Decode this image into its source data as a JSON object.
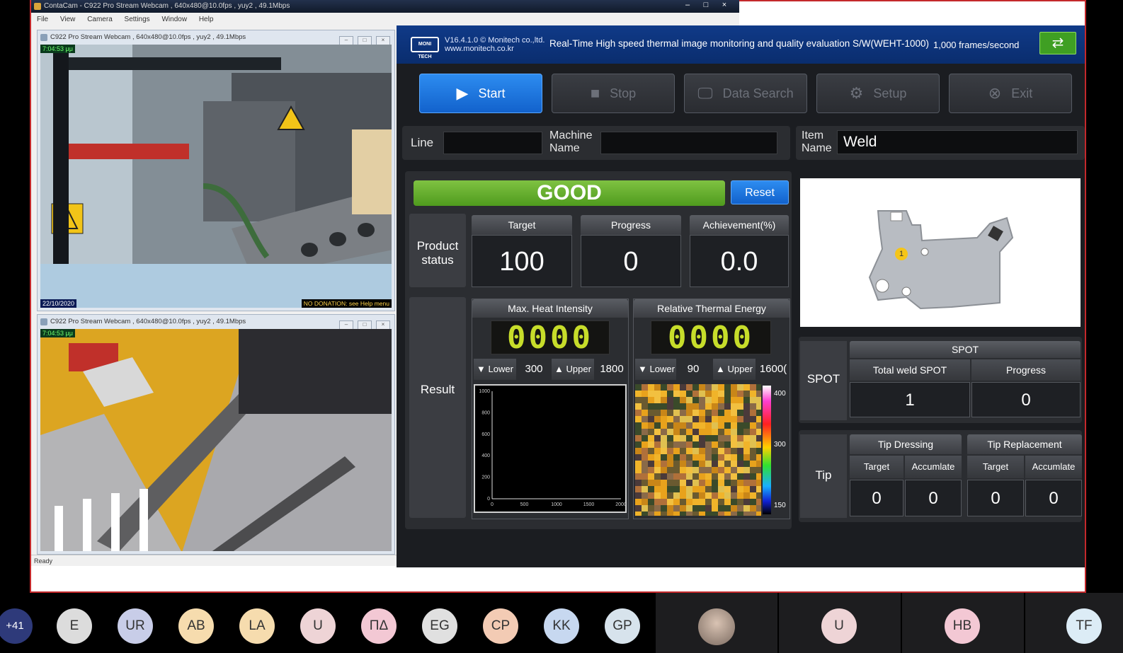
{
  "contacam": {
    "title": "ContaCam - C922 Pro Stream Webcam , 640x480@10.0fps , yuy2 , 49.1Mbps",
    "menu": [
      "File",
      "View",
      "Camera",
      "Settings",
      "Window",
      "Help"
    ],
    "window_controls": [
      "–",
      "□",
      "×"
    ],
    "cam1_title": "C922 Pro Stream Webcam , 640x480@10.0fps , yuy2 , 49.1Mbps",
    "cam2_title": "C922 Pro Stream Webcam , 640x480@10.0fps , yuy2 , 49.1Mbps",
    "cam1_timestamp": "7:04:53 μμ",
    "cam2_timestamp": "7:04:53 μμ",
    "cam1_date": "22/10/2020",
    "donation_text": "NO DONATION: see Help menu",
    "status": "Ready"
  },
  "app": {
    "version_line1": "V16.4.1.0 © Monitech co.,ltd.",
    "version_line2": "www.monitech.co.kr",
    "logo_text": "MONI TECH",
    "title": "Real-Time High speed thermal image monitoring and quality evaluation S/W(WEHT-1000)",
    "fps": "1,000 frames/second",
    "toolbar": {
      "start": "Start",
      "stop": "Stop",
      "data_search": "Data Search",
      "setup": "Setup",
      "exit": "Exit"
    },
    "line_label": "Line",
    "line_value": "",
    "machine_label_1": "Machine",
    "machine_label_2": "Name",
    "machine_value": "",
    "item_label_1": "Item",
    "item_label_2": "Name",
    "item_value": "Weld",
    "judgement": "GOOD",
    "reset": "Reset",
    "product_status_label_1": "Product",
    "product_status_label_2": "status",
    "target_label": "Target",
    "target_value": "100",
    "progress_label": "Progress",
    "progress_value": "0",
    "achievement_label": "Achievement(%)",
    "achievement_value": "0.0",
    "result_label": "Result",
    "heat_label": "Max. Heat Intensity",
    "heat_value": "0000",
    "heat_lower_label": "Lower",
    "heat_lower": "300",
    "heat_upper_label": "Upper",
    "heat_upper": "1800",
    "energy_label": "Relative Thermal Energy",
    "energy_value": "0000",
    "energy_lower_label": "Lower",
    "energy_lower": "90",
    "energy_upper_label": "Upper",
    "energy_upper": "1600(",
    "spot_side_label": "SPOT",
    "spot_header": "SPOT",
    "total_spot_label": "Total weld SPOT",
    "total_spot_value": "1",
    "spot_progress_label": "Progress",
    "spot_progress_value": "0",
    "tip_side_label": "Tip",
    "tip_dressing_label": "Tip Dressing",
    "tip_replacement_label": "Tip Replacement",
    "tip_target_label": "Target",
    "tip_accum_label": "Accumlate",
    "tip_dressing_target": "0",
    "tip_dressing_accum": "0",
    "tip_replacement_target": "0",
    "tip_replacement_accum": "0",
    "part_marker": "1",
    "colorbar_ticks": [
      "400",
      "300",
      "150"
    ]
  },
  "chart_data": {
    "type": "line",
    "title": "",
    "xlabel": "",
    "ylabel": "",
    "x_ticks": [
      "0",
      "500",
      "1000",
      "1500",
      "2000"
    ],
    "y_ticks": [
      "0",
      "200",
      "400",
      "600",
      "800",
      "1000"
    ],
    "xlim": [
      0,
      2000
    ],
    "ylim": [
      0,
      1000
    ],
    "series": []
  },
  "taskbar": {
    "avatars": [
      "+41",
      "E",
      "UR",
      "AB",
      "LA",
      "U",
      "ΠΔ",
      "EG",
      "CP",
      "KK",
      "GP"
    ],
    "tiles": [
      "U",
      "HB",
      "TF"
    ],
    "avatar_colors": [
      "#2e3a7a",
      "#dcdcdc",
      "#c8cde8",
      "#f6dcae",
      "#f6dcae",
      "#eed4d6",
      "#f3c8d4",
      "#e0e0e0",
      "#f3cbb4",
      "#c7d8f0",
      "#d7e3ec"
    ]
  }
}
